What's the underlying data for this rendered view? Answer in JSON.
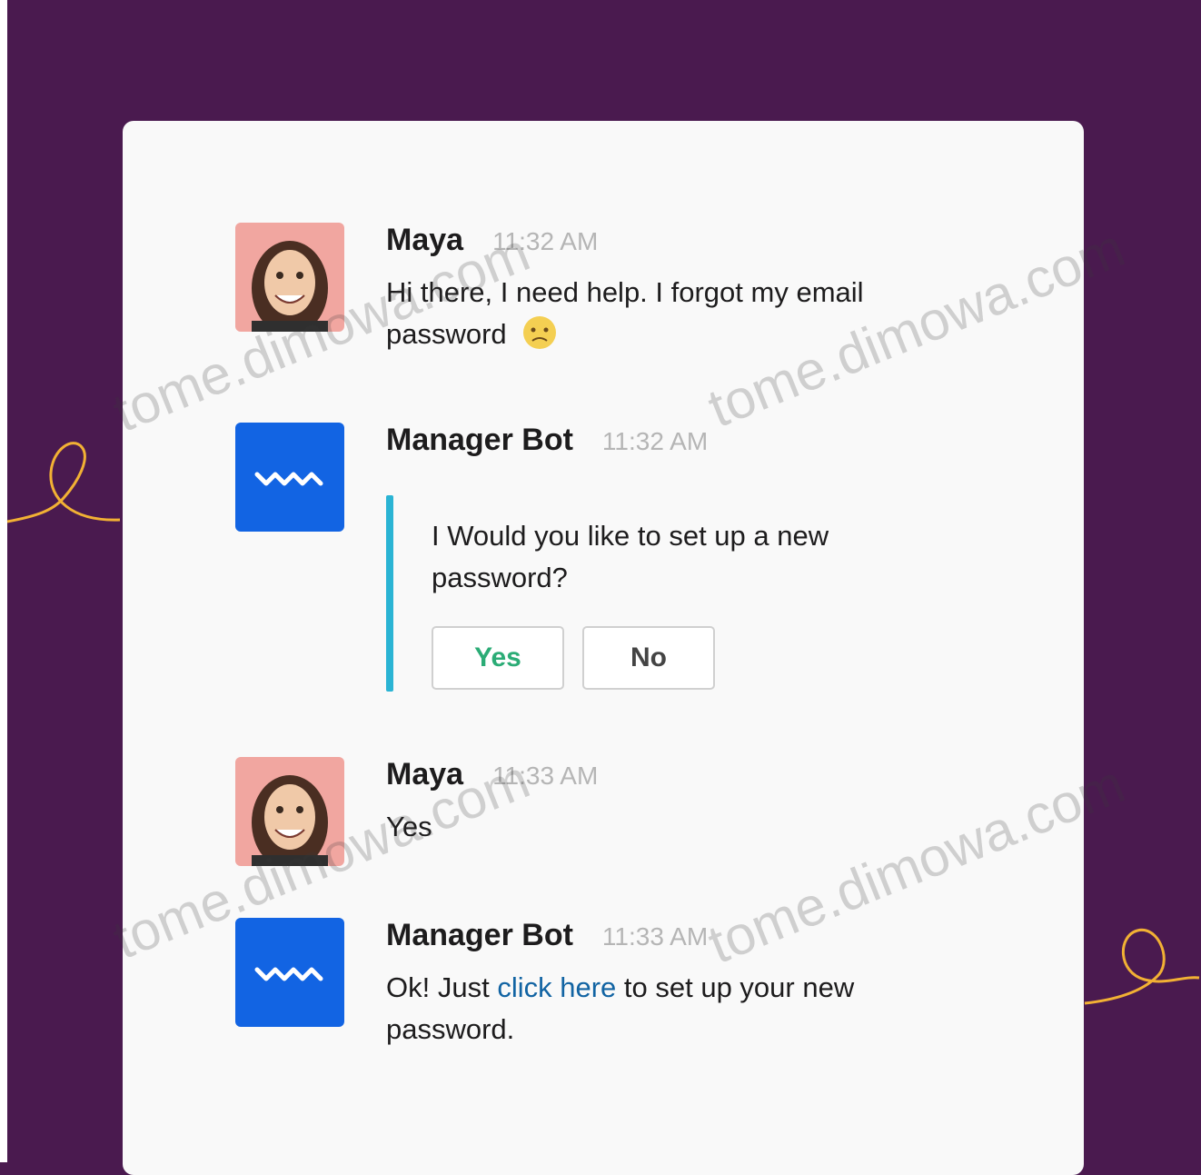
{
  "colors": {
    "background": "#4a1a4f",
    "card": "#f9f9f9",
    "bot_avatar": "#1264e3",
    "attachment_bar": "#2bb4d4",
    "yes_button_text": "#2bac76",
    "link": "#1264a3",
    "decor_line": "#f2b134"
  },
  "messages": [
    {
      "author": "Maya",
      "time": "11:32 AM",
      "avatar_icon": "user-photo-avatar",
      "text": "Hi there, I need help. I forgot my email password",
      "emoji": "worried-face-emoji"
    },
    {
      "author": "Manager Bot",
      "time": "11:32 AM",
      "avatar_icon": "bot-wave-icon",
      "attachment": {
        "text": "I Would you like to set up a new password?",
        "buttons": [
          {
            "label": "Yes"
          },
          {
            "label": "No"
          }
        ]
      }
    },
    {
      "author": "Maya",
      "time": "11:33 AM",
      "avatar_icon": "user-photo-avatar",
      "text": "Yes"
    },
    {
      "author": "Manager Bot",
      "time": "11:33 AM",
      "avatar_icon": "bot-wave-icon",
      "text_before": "Ok! Just",
      "link_text": "click here",
      "text_after": "to set up your new password."
    }
  ],
  "watermark": "tome.dimowa.com"
}
